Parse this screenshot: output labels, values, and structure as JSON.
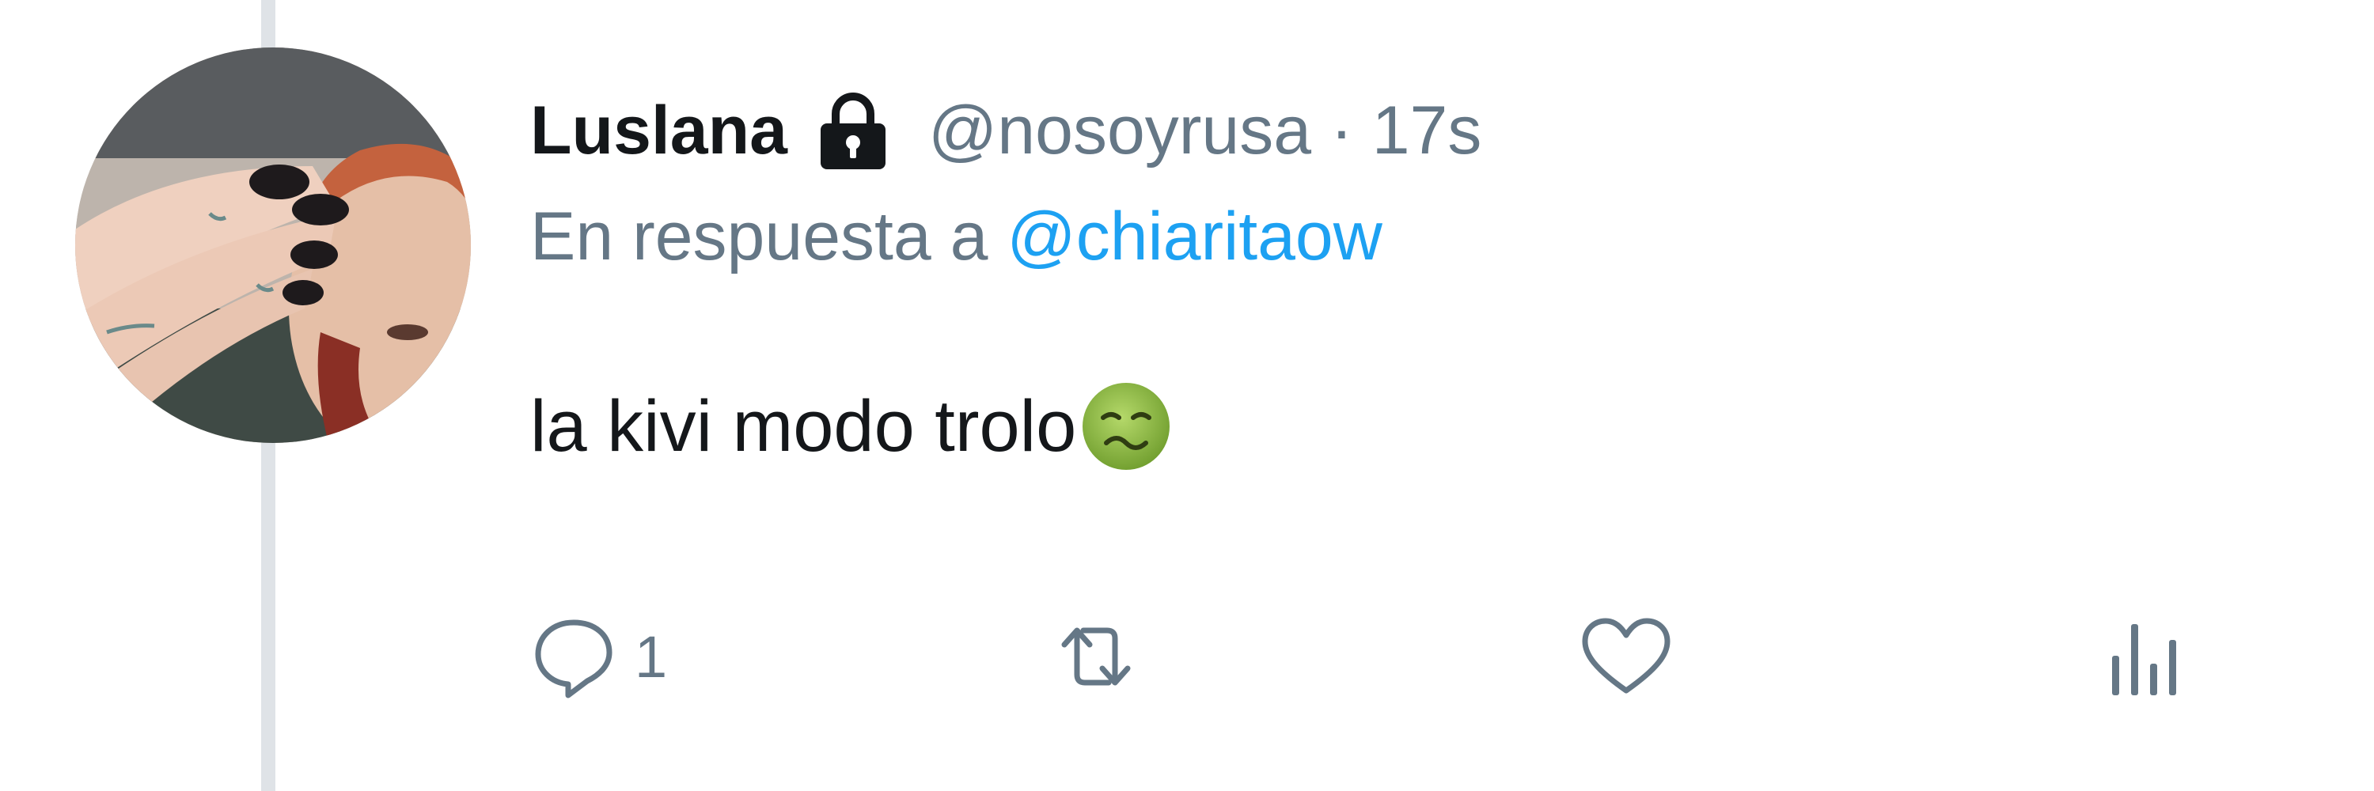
{
  "tweet": {
    "display_name": "Luslana",
    "handle": "@nosoyrusa",
    "separator": "·",
    "time": "17s",
    "reply_prefix": "En respuesta a",
    "reply_mention": "@chiaritaow",
    "text": "la kivi modo trolo",
    "emoji_icon": "nauseated-face-icon",
    "protected_icon": "lock-icon"
  },
  "actions": {
    "reply": {
      "icon": "reply-icon",
      "count": "1"
    },
    "retweet": {
      "icon": "retweet-icon"
    },
    "like": {
      "icon": "heart-icon"
    },
    "stats": {
      "icon": "analytics-icon"
    }
  },
  "colors": {
    "text_primary": "#14171a",
    "text_secondary": "#657786",
    "link": "#1da1f2",
    "thread_line": "#dfe3e7"
  }
}
